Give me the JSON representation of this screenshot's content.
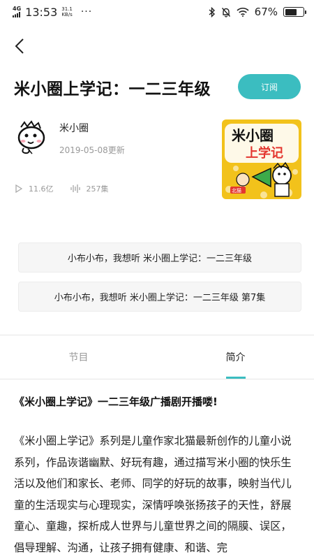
{
  "status_bar": {
    "network": "4G",
    "time": "13:53",
    "speed_value": "31.1",
    "speed_unit": "KB/s",
    "more": "···",
    "battery_text": "67%",
    "battery_level": 0.67
  },
  "program": {
    "title": "米小圈上学记：一二三年级",
    "subscribe_label": "订阅",
    "author": "米小圈",
    "updated": "2019-05-08更新",
    "plays": "11.6亿",
    "episodes": "257集",
    "cover": {
      "title": "米小圈",
      "subtitle": "上学记",
      "author": "北猫"
    }
  },
  "suggestions": [
    "小布小布，我想听 米小圈上学记：一二三年级",
    "小布小布，我想听 米小圈上学记：一二三年级 第7集"
  ],
  "tabs": [
    {
      "label": "节目",
      "active": false
    },
    {
      "label": "简介",
      "active": true
    }
  ],
  "intro": {
    "heading": "《米小圈上学记》一二三年级广播剧开播喽!",
    "body": "《米小圈上学记》系列是儿童作家北猫最新创作的儿童小说系列，作品诙谐幽默、好玩有趣，通过描写米小圈的快乐生活以及他们和家长、老师、同学的好玩的故事，映射当代儿童的生活现实与心理现实，深情呼唤张扬孩子的天性，舒展童心、童趣，探析成人世界与儿童世界之间的隔膜、误区，倡导理解、沟通，让孩子拥有健康、和谐、完"
  },
  "colors": {
    "accent": "#3bbdc0",
    "cover_bg": "#f2c21b"
  }
}
